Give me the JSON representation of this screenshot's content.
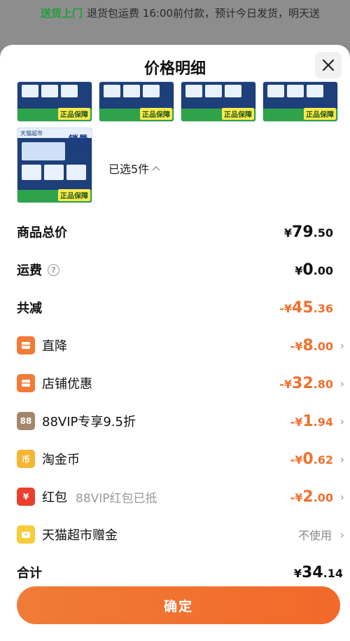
{
  "topbar": {
    "green_text": "送货上门",
    "rest_text": "退货包运费 16:00前付款，预计今日发货，明天送"
  },
  "sheet": {
    "title": "价格明细",
    "close_label": "关闭"
  },
  "products": {
    "selected_text": "已选5件",
    "thumb_badge": "正品保障",
    "thumb_lock": "锁量不漏",
    "thumb_brand": "天猫超市"
  },
  "rows": {
    "total": {
      "label": "商品总价",
      "currency": "¥",
      "int": "79",
      "cents": ".50"
    },
    "shipping": {
      "label": "运费",
      "info": "?",
      "currency": "¥",
      "int": "0",
      "cents": ".00"
    },
    "reduced": {
      "label": "共减",
      "currency": "-¥",
      "int": "45",
      "cents": ".36"
    },
    "direct": {
      "label": "直降",
      "icon": "ticket-icon",
      "currency": "-¥",
      "int": "8",
      "cents": ".00"
    },
    "store": {
      "label": "店铺优惠",
      "icon": "store-coupon-icon",
      "currency": "-¥",
      "int": "32",
      "cents": ".80"
    },
    "vip": {
      "label": "88VIP专享9.5折",
      "icon_text": "88",
      "currency": "-¥",
      "int": "1",
      "cents": ".94"
    },
    "taojin": {
      "label": "淘金币",
      "icon_text": "币",
      "currency": "-¥",
      "int": "0",
      "cents": ".62"
    },
    "hongbao": {
      "label": "红包",
      "sub": "88VIP红包已抵",
      "icon_text": "¥",
      "currency": "-¥",
      "int": "2",
      "cents": ".00"
    },
    "gift": {
      "label": "天猫超市赠金",
      "icon": "gift-card-icon",
      "value": "不使用"
    },
    "sum": {
      "label": "合计",
      "currency": "¥",
      "int": "34",
      "cents": ".14"
    }
  },
  "confirm": {
    "label": "确定"
  },
  "colors": {
    "accent": "#f0702e",
    "green": "#1f9e3e"
  }
}
